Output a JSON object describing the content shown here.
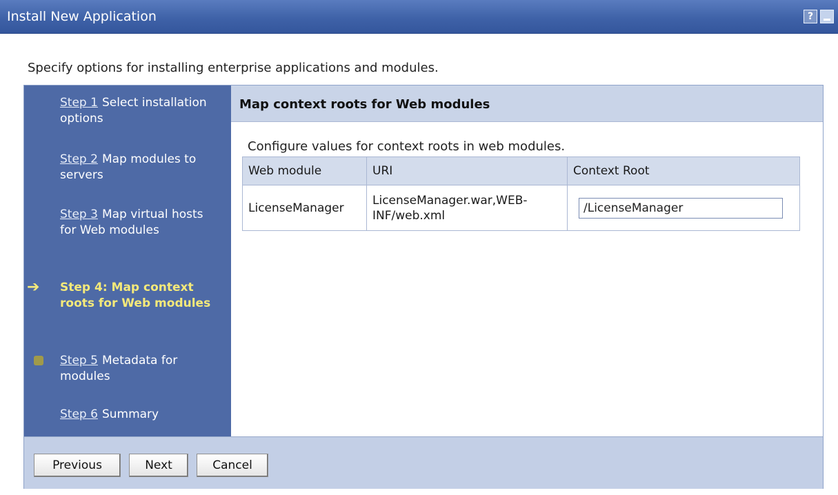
{
  "window": {
    "title": "Install New Application",
    "help_icon": "help-icon",
    "minimize_icon": "minimize-icon"
  },
  "intro": "Specify options for installing enterprise applications and modules.",
  "steps": [
    {
      "link": "Step 1",
      "label": "Select installation options",
      "state": "link"
    },
    {
      "link": "Step 2",
      "label": "Map modules to servers",
      "state": "link"
    },
    {
      "link": "Step 3",
      "label": "Map virtual hosts for Web modules",
      "state": "link"
    },
    {
      "link": "",
      "label": "Step 4: Map context roots for Web modules",
      "state": "current"
    },
    {
      "link": "Step 5",
      "label": "Metadata for modules",
      "state": "link"
    },
    {
      "link": "Step 6",
      "label": "Summary",
      "state": "link"
    }
  ],
  "current_step_icon": "arrow-right-icon",
  "pending_step_icon": "status-bullet-icon",
  "content": {
    "heading": "Map context roots for Web modules",
    "subtitle": "Configure values for context roots in web modules.",
    "table": {
      "headers": [
        "Web module",
        "URI",
        "Context Root"
      ],
      "rows": [
        {
          "web_module": "LicenseManager",
          "uri": "LicenseManager.war,WEB-INF/web.xml",
          "context_root": "/LicenseManager"
        }
      ]
    }
  },
  "buttons": {
    "previous": "Previous",
    "next": "Next",
    "cancel": "Cancel"
  },
  "colors": {
    "titlebar": "#3f62a8",
    "steps_panel": "#4e6aa6",
    "current_step": "#f4e97a",
    "header_band": "#c9d4e8"
  }
}
